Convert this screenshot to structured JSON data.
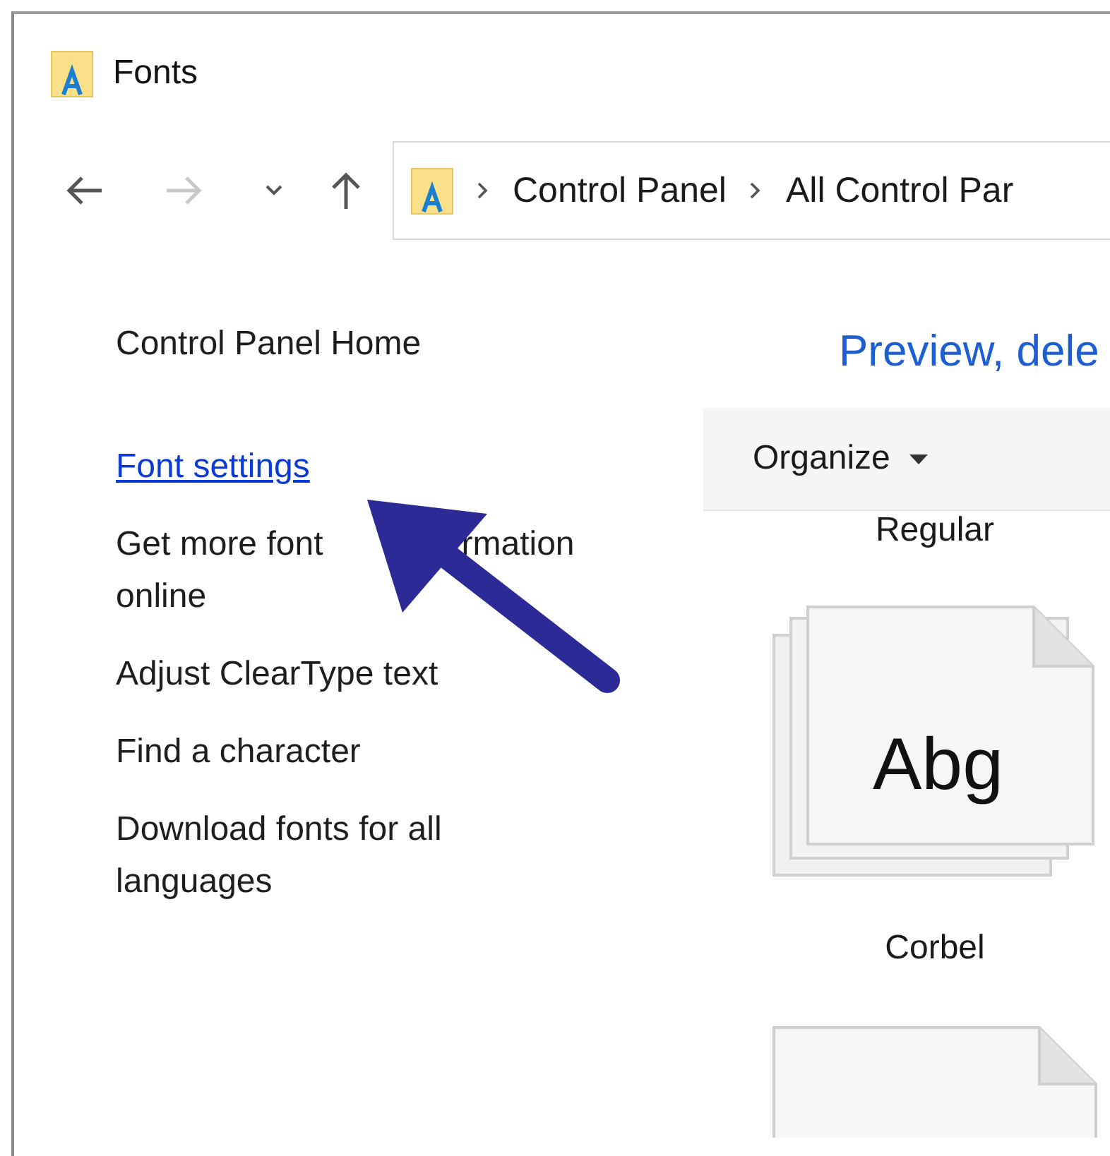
{
  "window": {
    "title": "Fonts"
  },
  "nav": [
    {
      "kind": "back",
      "disabled": false
    },
    {
      "kind": "forward",
      "disabled": true
    },
    {
      "kind": "recent",
      "disabled": false
    },
    {
      "kind": "up",
      "disabled": false
    }
  ],
  "address": {
    "crumbs": [
      "Control Panel",
      "All Control Par"
    ]
  },
  "sidebar": {
    "links": [
      {
        "label": "Control Panel Home",
        "kind": "home"
      },
      {
        "label": "Font settings",
        "kind": "link",
        "hovered": true
      },
      {
        "label_parts": [
          "Get more font",
          "rmation online"
        ],
        "kind": "link",
        "hovered": false
      },
      {
        "label": "Adjust ClearType text",
        "kind": "link",
        "hovered": false
      },
      {
        "label": "Find a character",
        "kind": "link",
        "hovered": false
      },
      {
        "label": "Download fonts for all languages",
        "kind": "link",
        "hovered": false
      }
    ]
  },
  "heading": "Preview, dele",
  "toolbar": {
    "menu": "Organize"
  },
  "items": [
    {
      "kind": "label",
      "text": "Regular"
    },
    {
      "kind": "family",
      "preview": "Abg",
      "label": "Corbel"
    },
    {
      "kind": "single"
    }
  ]
}
